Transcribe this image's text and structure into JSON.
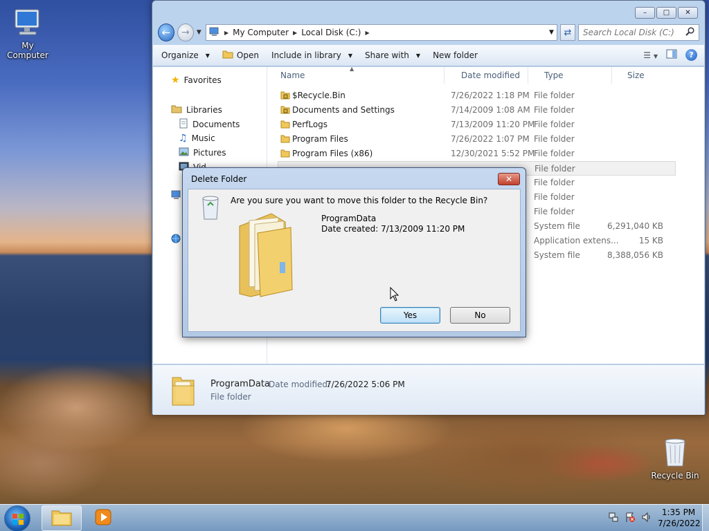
{
  "desktop": {
    "icons": [
      {
        "label": "My Computer"
      },
      {
        "label": "Recycle Bin"
      }
    ]
  },
  "explorer": {
    "window_buttons": {
      "minimize": "–",
      "maximize": "□",
      "close": "✕"
    },
    "breadcrumb": [
      "My Computer",
      "Local Disk (C:)"
    ],
    "search_placeholder": "Search Local Disk (C:)",
    "toolbar": {
      "organize": "Organize",
      "open": "Open",
      "include_in_library": "Include in library",
      "share_with": "Share with",
      "new_folder": "New folder"
    },
    "nav": {
      "favorites": "Favorites",
      "libraries": "Libraries",
      "documents": "Documents",
      "music": "Music",
      "pictures": "Pictures",
      "videos": "Vid"
    },
    "columns": {
      "name": "Name",
      "date_modified": "Date modified",
      "type": "Type",
      "size": "Size"
    },
    "files": [
      {
        "name": "$Recycle.Bin",
        "date": "7/26/2022 1:18 PM",
        "type": "File folder",
        "size": "",
        "locked": true
      },
      {
        "name": "Documents and Settings",
        "date": "7/14/2009 1:08 AM",
        "type": "File folder",
        "size": "",
        "locked": true
      },
      {
        "name": "PerfLogs",
        "date": "7/13/2009 11:20 PM",
        "type": "File folder",
        "size": ""
      },
      {
        "name": "Program Files",
        "date": "7/26/2022 1:07 PM",
        "type": "File folder",
        "size": ""
      },
      {
        "name": "Program Files (x86)",
        "date": "12/30/2021 5:52 PM",
        "type": "File folder",
        "size": ""
      },
      {
        "name": "",
        "date": "",
        "type": "File folder",
        "size": "",
        "selected": true
      },
      {
        "name": "",
        "date": "",
        "type": "File folder",
        "size": ""
      },
      {
        "name": "",
        "date": "",
        "type": "File folder",
        "size": ""
      },
      {
        "name": "",
        "date": "",
        "type": "File folder",
        "size": ""
      },
      {
        "name": "",
        "date": "",
        "type": "System file",
        "size": "6,291,040 KB"
      },
      {
        "name": "",
        "date": "",
        "type": "Application extens...",
        "size": "15 KB"
      },
      {
        "name": "",
        "date": "",
        "type": "System file",
        "size": "8,388,056 KB"
      }
    ],
    "details": {
      "name": "ProgramData",
      "date_label": "Date modified:",
      "date_value": "7/26/2022 5:06 PM",
      "type": "File folder"
    }
  },
  "dialog": {
    "title": "Delete Folder",
    "close_glyph": "✕",
    "question": "Are you sure you want to move this folder to the Recycle Bin?",
    "item_name": "ProgramData",
    "item_created": "Date created: 7/13/2009 11:20 PM",
    "yes_label": "Yes",
    "no_label": "No"
  },
  "taskbar": {
    "time": "1:35 PM",
    "date": "7/26/2022"
  },
  "colors": {
    "accent": "#2a6cc4",
    "folder": "#f0c75a",
    "dialog_default_button": "#bfe0f7",
    "close_red": "#c2402d"
  }
}
